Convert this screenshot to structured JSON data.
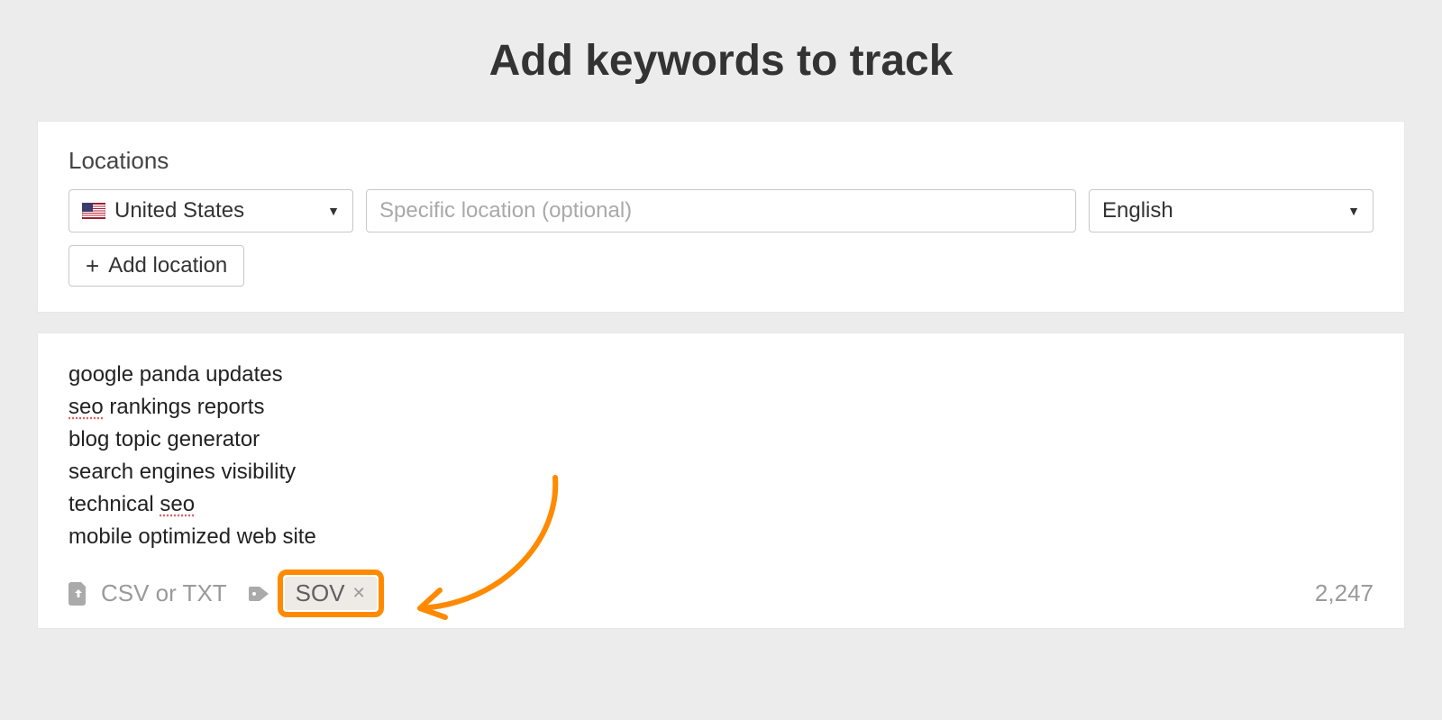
{
  "page": {
    "title": "Add keywords to track"
  },
  "locations": {
    "label": "Locations",
    "country": "United States",
    "specific_placeholder": "Specific location (optional)",
    "language": "English",
    "add_location_label": "Add location"
  },
  "keywords": {
    "lines": [
      "google panda updates",
      "seo rankings reports",
      "blog topic generator",
      "search engines visibility",
      "technical seo",
      "mobile optimized web site"
    ],
    "spellcheck_words": [
      "seo"
    ],
    "footer": {
      "upload_label": "CSV or TXT",
      "tag_name": "SOV",
      "counter": "2,247"
    }
  }
}
